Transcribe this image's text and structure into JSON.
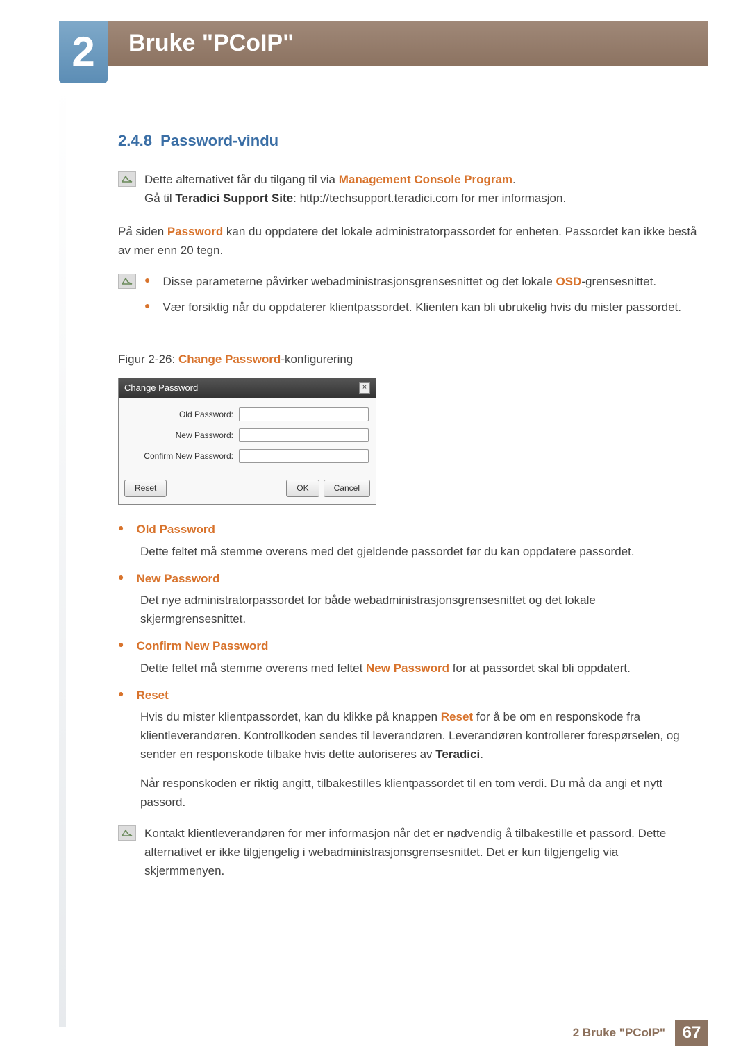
{
  "header": {
    "chapter_number": "2",
    "chapter_title": "Bruke \"PCoIP\""
  },
  "section": {
    "number": "2.4.8",
    "title": "Password-vindu"
  },
  "intro_note": {
    "line1_pre": "Dette alternativet får du tilgang til via ",
    "line1_accent": "Management Console Program",
    "line1_post": ".",
    "line2_pre": "Gå til ",
    "line2_bold": "Teradici Support Site",
    "line2_post": ": http://techsupport.teradici.com for mer informasjon."
  },
  "para1": {
    "pre": "På siden ",
    "accent": "Password",
    "post": " kan du oppdatere det lokale administratorpassordet for enheten. Passordet kan ikke bestå av mer enn 20 tegn."
  },
  "warn_bullets": {
    "b1_pre": "Disse parameterne påvirker webadministrasjonsgrensesnittet og det lokale ",
    "b1_accent": "OSD",
    "b1_post": "-grensesnittet.",
    "b2": "Vær forsiktig når du oppdaterer klientpassordet. Klienten kan bli ubrukelig hvis du mister passordet."
  },
  "figure_caption": {
    "pre": "Figur 2-26: ",
    "accent": "Change Password",
    "post": "-konfigurering"
  },
  "dialog": {
    "title": "Change Password",
    "close": "×",
    "old_pw_label": "Old Password:",
    "new_pw_label": "New Password:",
    "confirm_pw_label": "Confirm New Password:",
    "reset_btn": "Reset",
    "ok_btn": "OK",
    "cancel_btn": "Cancel"
  },
  "desc": {
    "old_pw_term": "Old Password",
    "old_pw_text": "Dette feltet må stemme overens med det gjeldende passordet før du kan oppdatere passordet.",
    "new_pw_term": "New Password",
    "new_pw_text": "Det nye administratorpassordet for både webadministrasjonsgrensesnittet og det lokale skjermgrensesnittet.",
    "confirm_pw_term": "Confirm New Password",
    "confirm_pw_pre": "Dette feltet må stemme overens med feltet ",
    "confirm_pw_accent": "New Password",
    "confirm_pw_post": " for at passordet skal bli oppdatert.",
    "reset_term": "Reset",
    "reset_p1_pre": "Hvis du mister klientpassordet, kan du klikke på knappen ",
    "reset_p1_accent": "Reset",
    "reset_p1_mid": " for å be om en responskode fra klientleverandøren. Kontrollkoden sendes til leverandøren. Leverandøren kontrollerer forespørselen, og sender en responskode tilbake hvis dette autoriseres av ",
    "reset_p1_bold": "Teradici",
    "reset_p1_post": ".",
    "reset_p2": "Når responskoden er riktig angitt, tilbakestilles klientpassordet til en tom verdi. Du må da angi et nytt passord."
  },
  "contact_note": "Kontakt klientleverandøren for mer informasjon når det er nødvendig å tilbakestille et passord. Dette alternativet er ikke tilgjengelig i webadministrasjonsgrensesnittet. Det er kun tilgjengelig via skjermmenyen.",
  "footer": {
    "label": "2 Bruke \"PCoIP\"",
    "page": "67"
  }
}
